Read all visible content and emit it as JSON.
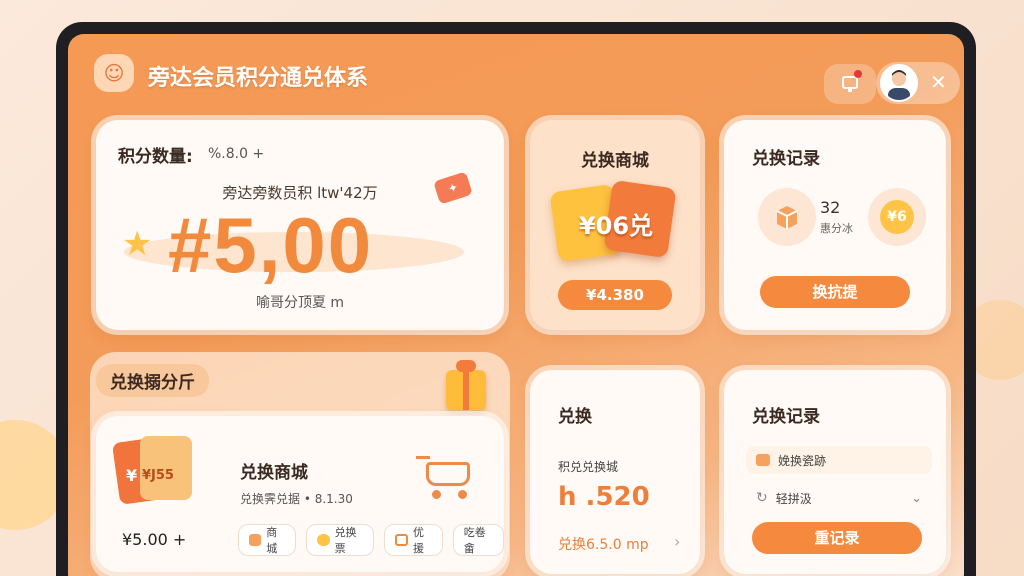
{
  "header": {
    "title": "旁达会员积分通兑体系",
    "logo_icon": "smiley-cloud-icon",
    "notification_icon": "bell-icon",
    "close_label": "✕"
  },
  "points_card": {
    "label": "积分数量:",
    "label_value": "%.8.0 +",
    "subtitle": "旁达旁数员积 ltw'42万",
    "big_value": "#5,00",
    "footer": "喻哥分顶夏 m"
  },
  "mall_card": {
    "title": "兑换商城",
    "coupon_text": "¥06兑",
    "button_label": "¥4.380"
  },
  "record_card": {
    "title": "兑换记录",
    "count": "32",
    "count_label": "惠分冰",
    "coin_text": "¥6",
    "button_label": "换抗提"
  },
  "exchange_section": {
    "tag": "兑换搦分斤",
    "title": "兑换商城",
    "description": "兑换霁兑据 • 8.1.30",
    "bag_label": "¥J55",
    "bag_yen": "¥",
    "price": "¥5.00 +",
    "chips": [
      {
        "label": "商城",
        "icon": "store-icon",
        "color": "#f6a25e"
      },
      {
        "label": "兑换票",
        "icon": "coin-icon",
        "color": "#ffc445"
      },
      {
        "label": "优援",
        "icon": "ticket-icon",
        "color": "#f08a3c"
      },
      {
        "label": "吃卷畲",
        "icon": "",
        "color": ""
      }
    ]
  },
  "rate_card": {
    "title": "兑换",
    "label": "积兑兑换城",
    "value": "h .520",
    "footer": "兑换6.5.0 mp",
    "chevron": "›"
  },
  "history_card": {
    "title": "兑换记录",
    "row1": "娩换瓷跡",
    "row2": "轻拼汲",
    "chevron": "⌄",
    "button_label": "重记录"
  },
  "colors": {
    "accent": "#f58a3e",
    "background": "#f59a55",
    "card": "#fffaf5"
  }
}
